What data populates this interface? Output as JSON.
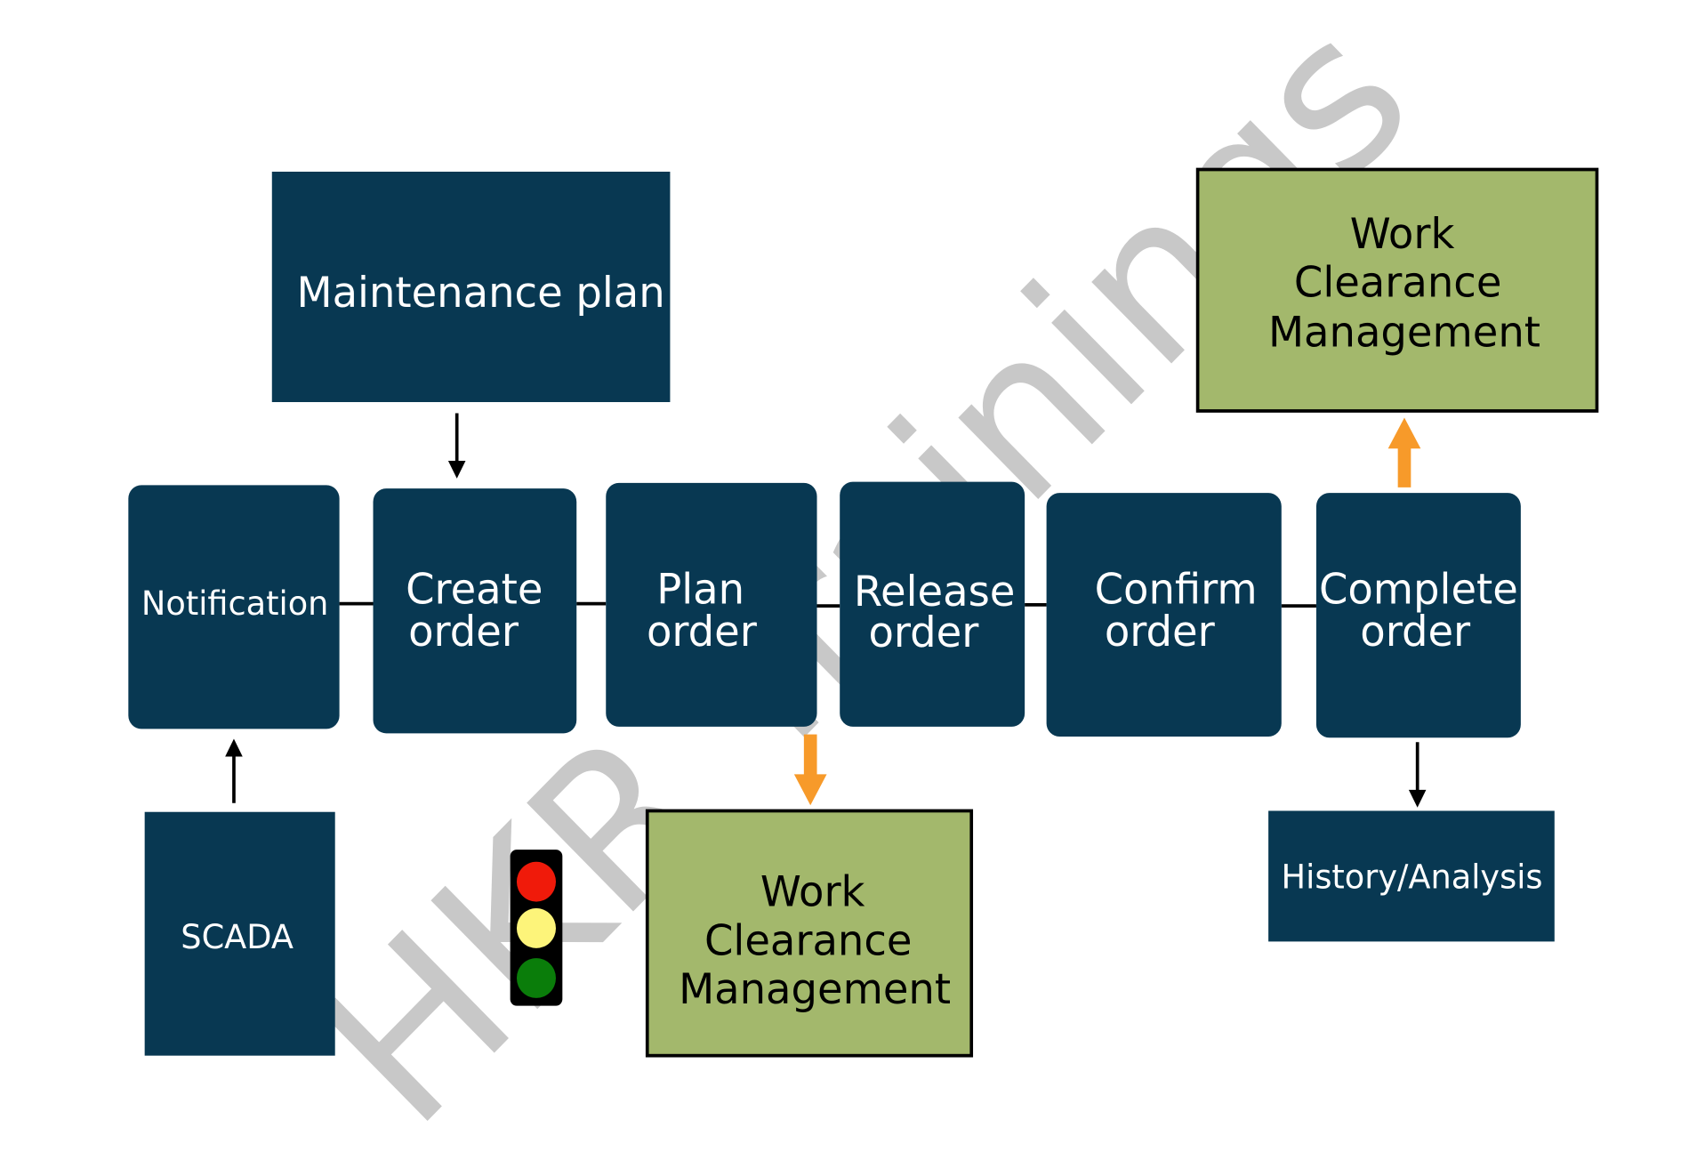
{
  "watermark": "HKR Trainings",
  "colors": {
    "box": "#083852",
    "clearance": "#a3b86c",
    "orange_arrow": "#f79a2a",
    "watermark": "#c8c8c8"
  },
  "nodes": {
    "maintenance_plan": "Maintenance plan",
    "notification": "Notification",
    "create_order": [
      "Create",
      "order"
    ],
    "plan_order": [
      "Plan",
      "order"
    ],
    "release_order": [
      "Release",
      "order"
    ],
    "confirm_order": [
      "Confirm",
      "order"
    ],
    "complete_order": [
      "Complete",
      "order"
    ],
    "wcm_top": [
      "Work",
      "Clearance",
      "Management"
    ],
    "wcm_bottom": [
      "Work",
      "Clearance",
      "Management"
    ],
    "scada": "SCADA",
    "history": "History/Analysis"
  },
  "traffic_light": {
    "colors": [
      "#f01a0a",
      "#fdf47a",
      "#0a7d0a"
    ]
  }
}
